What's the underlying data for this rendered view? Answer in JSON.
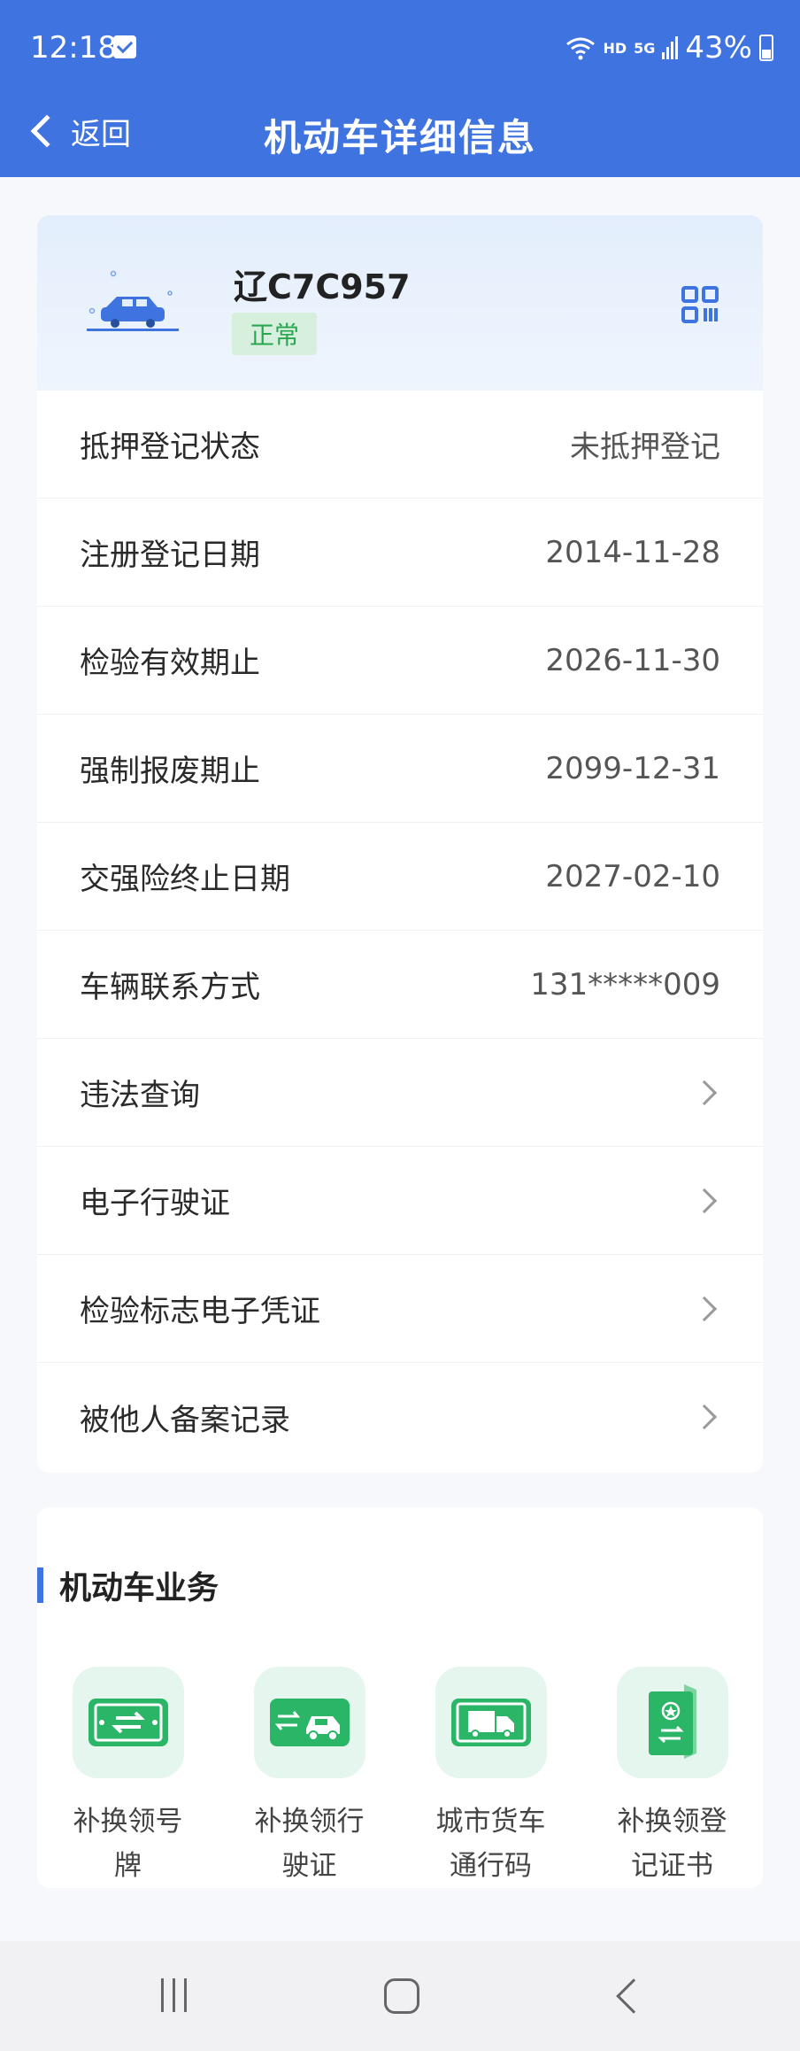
{
  "status_bar": {
    "time": "12:18",
    "network": "HD",
    "signal": "5G",
    "battery": "43%"
  },
  "nav": {
    "back_label": "返回",
    "title": "机动车详细信息"
  },
  "vehicle": {
    "plate": "辽C7C957",
    "status": "正常"
  },
  "info_rows": [
    {
      "label": "抵押登记状态",
      "value": "未抵押登记"
    },
    {
      "label": "注册登记日期",
      "value": "2014-11-28"
    },
    {
      "label": "检验有效期止",
      "value": "2026-11-30"
    },
    {
      "label": "强制报废期止",
      "value": "2099-12-31"
    },
    {
      "label": "交强险终止日期",
      "value": "2027-02-10"
    },
    {
      "label": "车辆联系方式",
      "value": "131*****009"
    }
  ],
  "link_rows": [
    {
      "label": "违法查询"
    },
    {
      "label": "电子行驶证"
    },
    {
      "label": "检验标志电子凭证"
    },
    {
      "label": "被他人备案记录"
    }
  ],
  "business": {
    "title": "机动车业务",
    "items": [
      {
        "label": "补换领号牌",
        "icon": "license-plate-swap-icon"
      },
      {
        "label": "补换领行驶证",
        "icon": "car-swap-icon"
      },
      {
        "label": "城市货车通行码",
        "icon": "truck-icon"
      },
      {
        "label": "补换领登记证书",
        "icon": "certificate-swap-icon"
      }
    ]
  },
  "colors": {
    "primary": "#3f73e0",
    "accent_green": "#2ab567",
    "badge_bg": "#d7f0de"
  }
}
